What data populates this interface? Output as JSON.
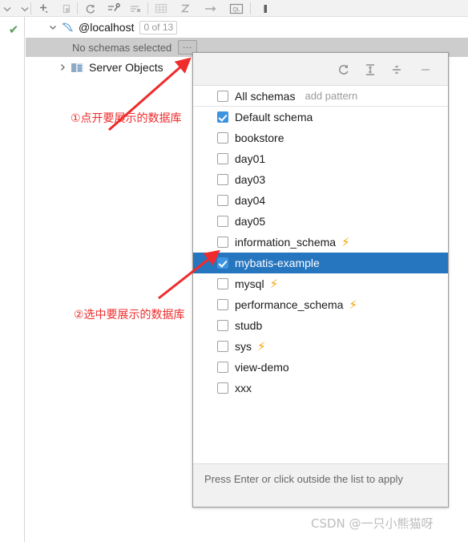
{
  "toolbar": {
    "icons": [
      {
        "name": "chevron-down-icon",
        "glyph": "⌄"
      },
      {
        "name": "add-icon",
        "glyph": "+"
      },
      {
        "name": "copy-icon",
        "glyph": "❐"
      },
      {
        "name": "refresh-icon",
        "glyph": "↻"
      },
      {
        "name": "db-tools-icon",
        "glyph": "⚙"
      },
      {
        "name": "data-editor-icon",
        "glyph": "≡"
      },
      {
        "name": "table-icon",
        "glyph": "▦"
      },
      {
        "name": "sort-icon",
        "glyph": "⤵"
      },
      {
        "name": "jump-to-icon",
        "glyph": "→"
      },
      {
        "name": "sql-console-icon",
        "glyph": "QL"
      },
      {
        "name": "marker-icon",
        "glyph": "█"
      }
    ]
  },
  "tree": {
    "status_ok": "✔",
    "localhost": {
      "expand_glyph": "⌄",
      "label": "@localhost",
      "count_badge": "0 of 13"
    },
    "no_schemas": {
      "label": "No schemas selected",
      "ellipsis_label": "..."
    },
    "server_objects": {
      "expand_glyph": "›",
      "label": "Server Objects"
    }
  },
  "popup": {
    "header_buttons": [
      {
        "name": "refresh-icon",
        "glyph": "↻"
      },
      {
        "name": "expand-all-icon",
        "glyph": "↧"
      },
      {
        "name": "collapse-all-icon",
        "glyph": "↥"
      },
      {
        "name": "minimize-icon",
        "glyph": "—"
      }
    ],
    "items": [
      {
        "label": "All schemas",
        "checked": false,
        "bolt": false,
        "selected": false,
        "extra": "add pattern",
        "separator": true
      },
      {
        "label": "Default schema",
        "checked": true,
        "bolt": false,
        "selected": false,
        "extra": "",
        "separator": false
      },
      {
        "label": "bookstore",
        "checked": false,
        "bolt": false,
        "selected": false,
        "extra": "",
        "separator": false
      },
      {
        "label": "day01",
        "checked": false,
        "bolt": false,
        "selected": false,
        "extra": "",
        "separator": false
      },
      {
        "label": "day03",
        "checked": false,
        "bolt": false,
        "selected": false,
        "extra": "",
        "separator": false
      },
      {
        "label": "day04",
        "checked": false,
        "bolt": false,
        "selected": false,
        "extra": "",
        "separator": false
      },
      {
        "label": "day05",
        "checked": false,
        "bolt": false,
        "selected": false,
        "extra": "",
        "separator": false
      },
      {
        "label": "information_schema",
        "checked": false,
        "bolt": true,
        "selected": false,
        "extra": "",
        "separator": false
      },
      {
        "label": "mybatis-example",
        "checked": true,
        "bolt": false,
        "selected": true,
        "extra": "",
        "separator": false
      },
      {
        "label": "mysql",
        "checked": false,
        "bolt": true,
        "selected": false,
        "extra": "",
        "separator": false
      },
      {
        "label": "performance_schema",
        "checked": false,
        "bolt": true,
        "selected": false,
        "extra": "",
        "separator": false
      },
      {
        "label": "studb",
        "checked": false,
        "bolt": false,
        "selected": false,
        "extra": "",
        "separator": false
      },
      {
        "label": "sys",
        "checked": false,
        "bolt": true,
        "selected": false,
        "extra": "",
        "separator": false
      },
      {
        "label": "view-demo",
        "checked": false,
        "bolt": false,
        "selected": false,
        "extra": "",
        "separator": false
      },
      {
        "label": "xxx",
        "checked": false,
        "bolt": false,
        "selected": false,
        "extra": "",
        "separator": false
      }
    ],
    "bolt_glyph": "⚡",
    "hint": "Press Enter or click outside the list to apply"
  },
  "annotations": {
    "step1": "①点开要展示的数据库",
    "step2": "②选中要展示的数据库",
    "color": "#ef2b2b"
  },
  "watermark": "CSDN @一只小熊猫呀",
  "colors": {
    "selection_blue": "#2675bf",
    "checkbox_blue": "#3c93e0",
    "bolt_orange": "#f5a302",
    "row_gray": "#cdcdcd",
    "panel_gray": "#f1f1f1"
  }
}
